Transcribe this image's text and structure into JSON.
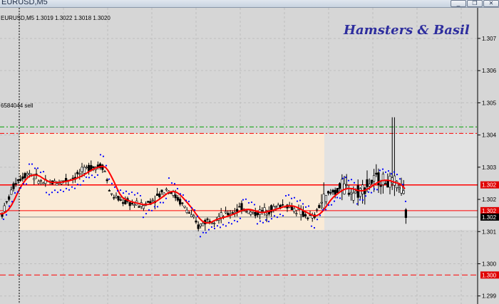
{
  "window": {
    "title": "EURUSD,M5",
    "buttons": [
      {
        "name": "minimize-button",
        "glyph": "_"
      },
      {
        "name": "restore-button",
        "glyph": "❐"
      },
      {
        "name": "close-button",
        "glyph": "✕"
      }
    ]
  },
  "chart": {
    "info": "EURUSD,M5  1.3019 1.3022 1.3018 1.3020",
    "watermark": "Hamsters & Basil",
    "order_label": "6584044 sell",
    "y_range": [
      1.29875,
      1.30795
    ],
    "y_ticks": [
      "1.307",
      "1.306",
      "1.305",
      "1.304",
      "1.303",
      "1.302",
      "1.301",
      "1.300",
      "1.299"
    ],
    "price_tags": [
      {
        "price": 1.30245,
        "text": "1.302"
      },
      {
        "price": 1.30165,
        "text": "1.302"
      },
      {
        "price": 1.30145,
        "text": "1.302"
      },
      {
        "price": 1.29965,
        "text": "1.300"
      }
    ],
    "levels": {
      "take_profit": 1.30425,
      "entry": 1.30405,
      "stop_zone": 1.29965,
      "upper_red": 1.30245,
      "lower_red": 1.30165
    },
    "boxes": {
      "range_high": 1.30405,
      "range_low": 1.30105,
      "bid_line": 1.30145
    },
    "colors": {
      "background": "#d6d6d6",
      "box": "#faebd7",
      "candles": "#000000",
      "moving_average": "#ff0000",
      "sar": "#0000ff",
      "take_profit_line": "#00a000",
      "level_lines": "#ff0000",
      "tag_bg": "#e00000",
      "current_tag_bg": "#000000"
    }
  }
}
